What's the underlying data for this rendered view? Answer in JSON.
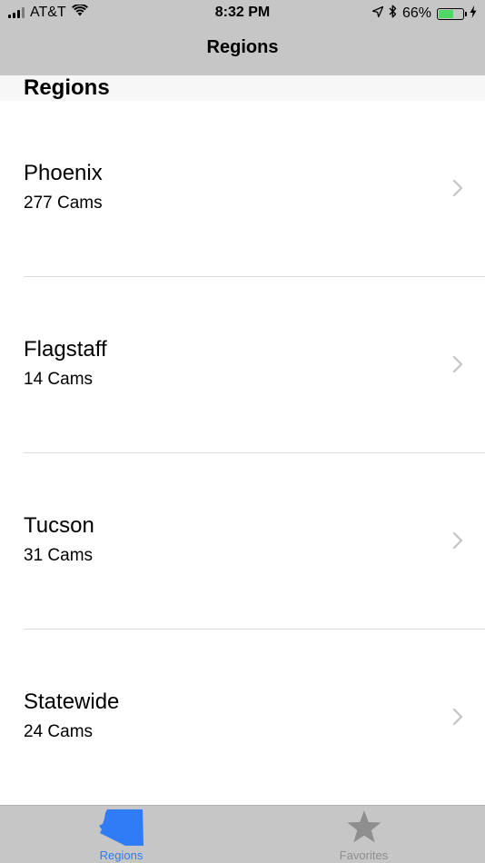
{
  "status_bar": {
    "carrier": "AT&T",
    "time": "8:32 PM",
    "battery_percent": "66%",
    "battery_level": 0.66,
    "icons": [
      "signal-icon",
      "wifi-icon",
      "location-arrow-icon",
      "bluetooth-icon",
      "battery-icon",
      "charging-bolt-icon"
    ]
  },
  "nav": {
    "title": "Regions"
  },
  "section": {
    "header": "Regions"
  },
  "regions": [
    {
      "name": "Phoenix",
      "count": "277 Cams"
    },
    {
      "name": "Flagstaff",
      "count": "14 Cams"
    },
    {
      "name": "Tucson",
      "count": "31 Cams"
    },
    {
      "name": "Statewide",
      "count": "24 Cams"
    }
  ],
  "tabs": [
    {
      "label": "Regions",
      "icon": "arizona-state-icon",
      "active": true
    },
    {
      "label": "Favorites",
      "icon": "star-icon",
      "active": false
    }
  ],
  "colors": {
    "bars": "#c6c6c6",
    "accent": "#2f7cf6",
    "inactive": "#8e8e8e",
    "battery": "#4cd964"
  }
}
